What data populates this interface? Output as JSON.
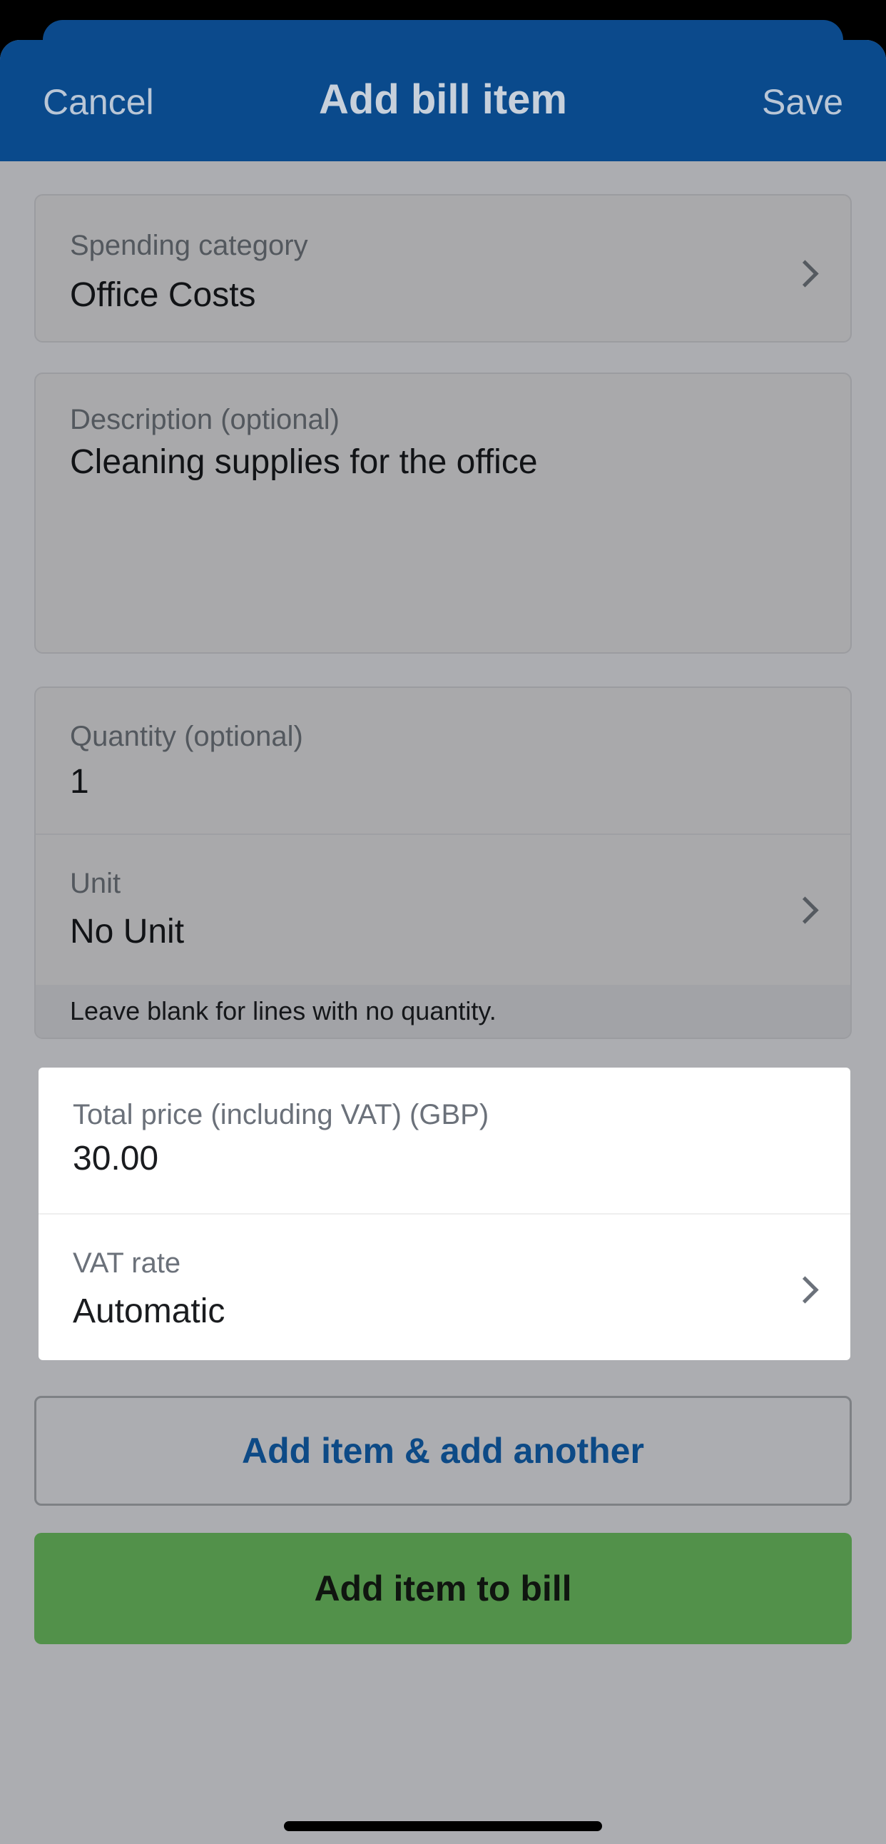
{
  "header": {
    "cancel_label": "Cancel",
    "title": "Add bill item",
    "save_label": "Save"
  },
  "spending_category": {
    "label": "Spending category",
    "value": "Office Costs"
  },
  "description": {
    "label": "Description (optional)",
    "value": "Cleaning supplies for the office"
  },
  "quantity": {
    "label": "Quantity (optional)",
    "value": "1"
  },
  "unit": {
    "label": "Unit",
    "value": "No Unit",
    "hint": "Leave blank for lines with no quantity."
  },
  "total_price": {
    "label": "Total price (including VAT) (GBP)",
    "value": "30.00"
  },
  "vat_rate": {
    "label": "VAT rate",
    "value": "Automatic"
  },
  "buttons": {
    "add_another": "Add item & add another",
    "add_to_bill": "Add item to bill"
  },
  "colors": {
    "header": "#0a4a8c",
    "accent_text": "#0d4a86",
    "primary_button": "#52914a",
    "overlay_background": "#acadb1"
  },
  "icons": {
    "row_chevron": "chevron-right-icon"
  }
}
